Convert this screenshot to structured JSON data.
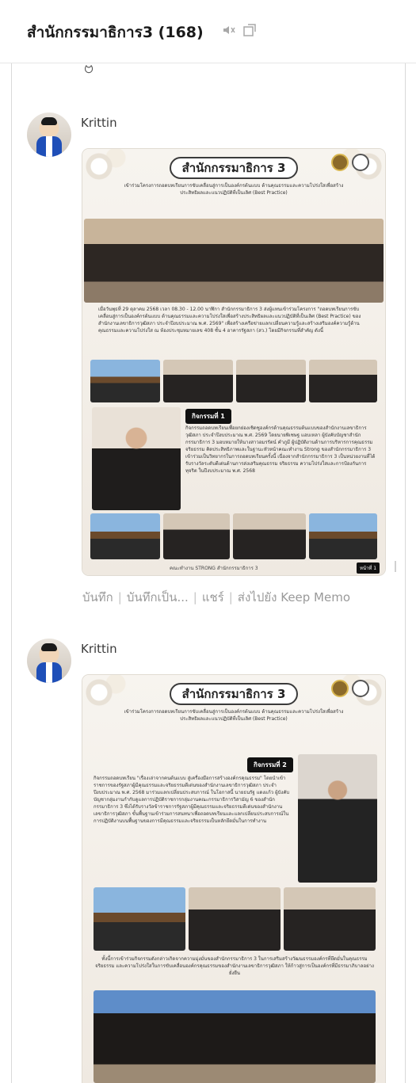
{
  "header": {
    "title": "สำนักกรรมาธิการ3 (168)",
    "mute_icon": "speaker-muted-icon",
    "popout_icon": "popout-window-icon"
  },
  "emoji_peek": "ဗ",
  "messages": [
    {
      "author": "Krittin",
      "poster": {
        "title": "สำนักกรรมาธิการ 3",
        "subtitle": "เข้าร่วมโครงการถอดบทเรียนการขับเคลื่อนสู่การเป็นองค์กรต้นแบบ ด้านคุณธรรมและความโปร่งใสเพื่อสร้างประสิทธิผลและแนวปฏิบัติที่เป็นเลิศ (Best Practice)",
        "body1": "เมื่อวันพุธที่ 29 ตุลาคม 2568 เวลา 08.30 - 12.00 นาฬิกา สำนักกรรมาธิการ 3 ส่งผู้แทนเข้าร่วมโครงการ \"ถอดบทเรียนการขับเคลื่อนสู่การเป็นองค์กรต้นแบบ ด้านคุณธรรมและความโปร่งใสเพื่อสร้างประสิทธิผลและแนวปฏิบัติที่เป็นเลิศ (Best Practice) ของสำนักงานเลขาธิการวุฒิสภา ประจำปีงบประมาณ พ.ศ. 2569\" เพื่อสร้างเครือข่ายแลกเปลี่ยนความรู้และสร้างเสริมองค์ความรู้ด้านคุณธรรมและความโปร่งใส ณ ห้องประชุมหมายเลข 408 ชั้น 4 อาคารรัฐสภา (สว.) โดยมีกิจกรรมที่สำคัญ ดังนี้",
        "activity_label": "กิจกรรมที่ 1",
        "body2": "กิจกรรมถอดบทเรียนเพื่อยกย่องเชิดชูองค์กรด้านคุณธรรมต้นแบบของสำนักงานเลขาธิการวุฒิสภา ประจำปีงบประมาณ พ.ศ. 2569 โดยนายพิเชษฐ แอบเหลา ผู้บังคับบัญชาสำนักกรรมาธิการ 3 มอบหมายให้นางสาวอมรรัตน์ คำภูมี ผู้ปฏิบัติงานด้านการบริหารการคุณธรรม จริยธรรม คิดประสิทธิภาพและในฐานะหัวหน้าคณะทำงาน Strong ของสำนักกรรมาธิการ 3 เข้าร่วมเป็นวิทยากรในการถอดบทเรียนครั้งนี้ เนื่องจากสำนักกรรมาธิการ 3 เป็นหน่วยงานที่ได้รับรางวัลระดับดีเด่นด้านการส่งเสริมคุณธรรม จริยธรรม ความโปร่งใสและการป้องกันการทุจริต ในปีงบประมาณ พ.ศ. 2568",
        "footer": "คณะทำงาน STRONG สำนักกรรมาธิการ 3",
        "page_tag": "หน้าที่ 1"
      }
    },
    {
      "author": "Krittin",
      "poster": {
        "title": "สำนักกรรมาธิการ 3",
        "subtitle": "เข้าร่วมโครงการถอดบทเรียนการขับเคลื่อนสู่การเป็นองค์กรต้นแบบ ด้านคุณธรรมและความโปร่งใสเพื่อสร้างประสิทธิผลและแนวปฏิบัติที่เป็นเลิศ (Best Practice)",
        "activity_label": "กิจกรรมที่ 2",
        "body1": "กิจกรรมถอดบทเรียน \"เรื่องเล่าจากคนต้นแบบ สู่เครื่องมือการสร้างองค์กรคุณธรรม\" โดยนำเข้าราชการของรัฐสภาผู้มีคุณธรรมและจริยธรรมดีเด่นของสำนักงานเลขาธิการวุฒิสภา ประจำปีงบประมาณ พ.ศ. 2568 มาร่วมแลกเปลี่ยนประสบการณ์ ในโอกาสนี้ นายธนรัฐ แดงแก้ว ผู้บังคับบัญชากลุ่มงานกำกับดูแลการปฏิบัติราชการกลุ่มงานคณะกรรมาธิการวิสามัญ 6 ของสำนักกรรมาธิการ 3 ซึ่งได้รับรางวัลข้าราชการรัฐสภาผู้มีคุณธรรมและจริยธรรมดีเด่นของสำนักงานเลขาธิการวุฒิสภา ขั้นพื้นฐานเข้าร่วมการสนทนาเพื่อถอดบทเรียนและแลกเปลี่ยนประสบการณ์ในการปฏิบัติงานบนพื้นฐานของการมีคุณธรรมและจริยธรรมเป็นหลักยึดมั่นในการทำงาน",
        "body2": "ทั้งนี้การเข้าร่วมกิจกรรมดังกล่าวเกิดจากความมุ่งมั่นของสำนักกรรมาธิการ 3 ในการเสริมสร้างวัฒนธรรมองค์กรที่ยึดมั่นในคุณธรรม จริยธรรม และความโปร่งใสในการขับเคลื่อนองค์กรคุณธรรมของสำนักงานเลขาธิการวุฒิสภา ให้ก้าวสู่การเป็นองค์กรที่มีธรรมาภิบาลอย่างยั่งยืน"
      }
    }
  ],
  "actions": {
    "save": "บันทึก",
    "save_as": "บันทึกเป็น...",
    "share": "แชร์",
    "keep": "ส่งไปยัง Keep Memo"
  }
}
